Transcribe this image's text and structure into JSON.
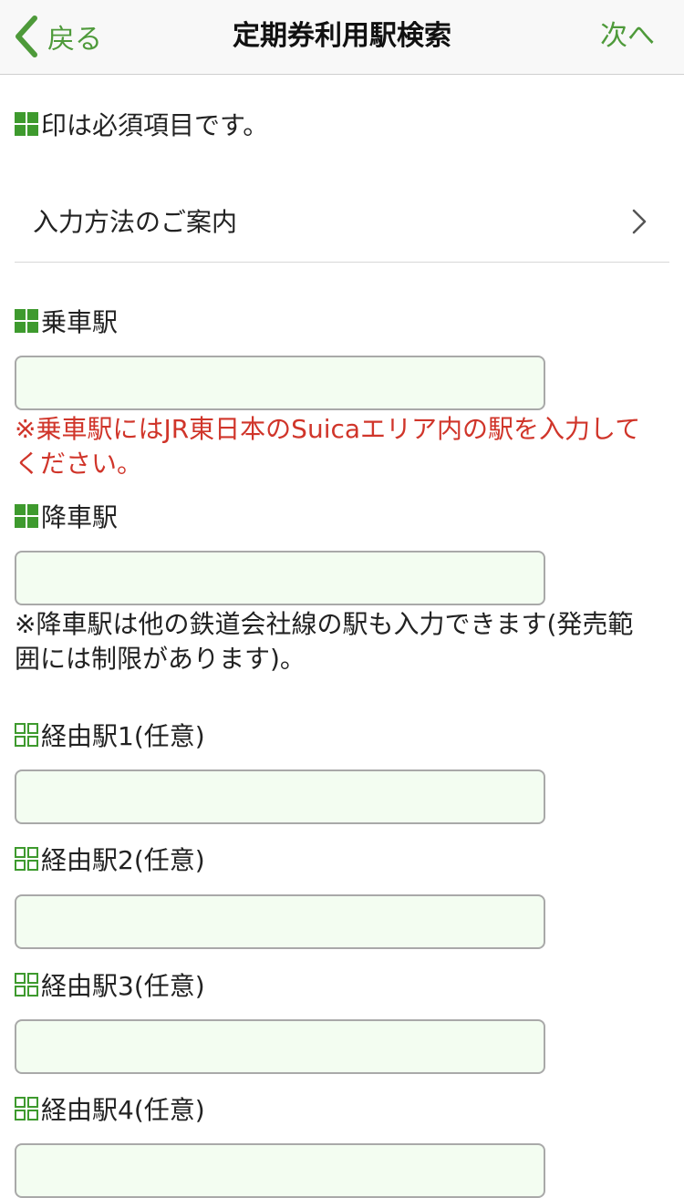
{
  "navbar": {
    "back_label": "戻る",
    "title": "定期券利用駅検索",
    "next_label": "次へ"
  },
  "required_note": "印は必須項目です。",
  "guide_row": {
    "label": "入力方法のご案内"
  },
  "fields": {
    "boarding": {
      "label": "乗車駅",
      "value": "",
      "hint": "※乗車駅にはJR東日本のSuicaエリア内の駅を入力してください。"
    },
    "alighting": {
      "label": "降車駅",
      "value": "",
      "hint": "※降車駅は他の鉄道会社線の駅も入力できます(発売範囲には制限があります)。"
    },
    "via1": {
      "label": "経由駅1(任意)",
      "value": ""
    },
    "via2": {
      "label": "経由駅2(任意)",
      "value": ""
    },
    "via3": {
      "label": "経由駅3(任意)",
      "value": ""
    },
    "via4": {
      "label": "経由駅4(任意)",
      "value": ""
    }
  },
  "colors": {
    "accent_green": "#4e9a3a",
    "mark_green": "#3e9a2e",
    "warning_red": "#d0352a",
    "input_bg": "#f3fdf1"
  },
  "icons": {
    "back": "chevron-left-icon",
    "guide": "chevron-right-icon",
    "required": "required-mark-icon",
    "optional": "optional-mark-icon"
  }
}
